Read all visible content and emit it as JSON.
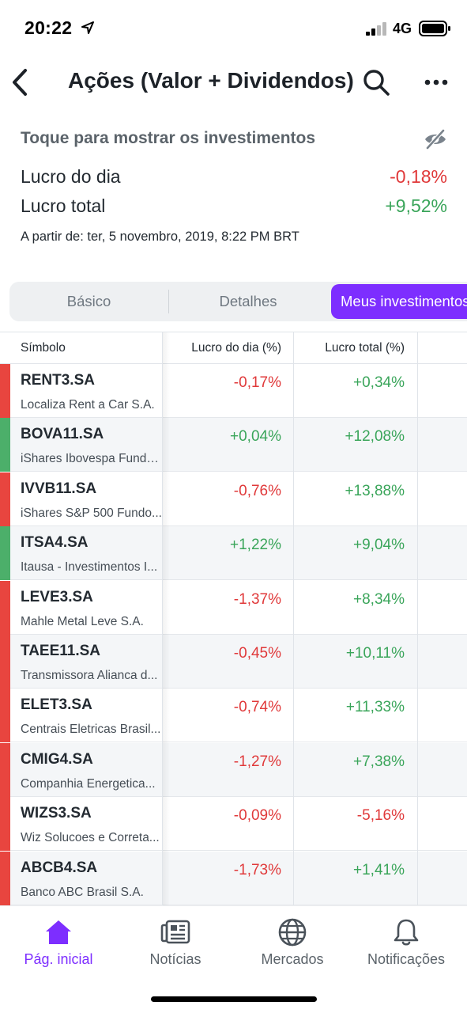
{
  "status_bar": {
    "time": "20:22",
    "network": "4G"
  },
  "header": {
    "title": "Ações (Valor + Dividendos)"
  },
  "summary": {
    "tap_hint": "Toque para mostrar os investimentos",
    "day_profit_label": "Lucro do dia",
    "day_profit_value": "-0,18%",
    "total_profit_label": "Lucro total",
    "total_profit_value": "+9,52%",
    "as_of": "A partir de: ter, 5 novembro, 2019, 8:22 PM BRT"
  },
  "tabs": [
    {
      "label": "Básico"
    },
    {
      "label": "Detalhes"
    },
    {
      "label": "Meus investimentos",
      "active": true
    }
  ],
  "table": {
    "columns": {
      "symbol": "Símbolo",
      "day": "Lucro do dia (%)",
      "total": "Lucro total (%)"
    },
    "rows": [
      {
        "symbol": "RENT3.SA",
        "name": "Localiza Rent a Car S.A.",
        "day": "-0,17%",
        "total": "+0,34%",
        "extra": "",
        "trend": "down"
      },
      {
        "symbol": "BOVA11.SA",
        "name": "iShares Ibovespa Fundo...",
        "day": "+0,04%",
        "total": "+12,08%",
        "extra": "+",
        "trend": "up"
      },
      {
        "symbol": "IVVB11.SA",
        "name": "iShares S&P 500 Fundo...",
        "day": "-0,76%",
        "total": "+13,88%",
        "extra": "+",
        "trend": "down"
      },
      {
        "symbol": "ITSA4.SA",
        "name": "Itausa - Investimentos I...",
        "day": "+1,22%",
        "total": "+9,04%",
        "extra": "+",
        "trend": "up"
      },
      {
        "symbol": "LEVE3.SA",
        "name": "Mahle Metal Leve S.A.",
        "day": "-1,37%",
        "total": "+8,34%",
        "extra": "",
        "trend": "down"
      },
      {
        "symbol": "TAEE11.SA",
        "name": "Transmissora Alianca d...",
        "day": "-0,45%",
        "total": "+10,11%",
        "extra": "",
        "trend": "down"
      },
      {
        "symbol": "ELET3.SA",
        "name": "Centrais Eletricas Brasil...",
        "day": "-0,74%",
        "total": "+11,33%",
        "extra": "",
        "trend": "down"
      },
      {
        "symbol": "CMIG4.SA",
        "name": "Companhia Energetica...",
        "day": "-1,27%",
        "total": "+7,38%",
        "extra": "",
        "trend": "down"
      },
      {
        "symbol": "WIZS3.SA",
        "name": "Wiz Solucoes e Correta...",
        "day": "-0,09%",
        "total": "-5,16%",
        "extra": "",
        "trend": "down"
      },
      {
        "symbol": "ABCB4.SA",
        "name": "Banco ABC Brasil S.A.",
        "day": "-1,73%",
        "total": "+1,41%",
        "extra": "",
        "trend": "down"
      }
    ]
  },
  "bottom_nav": [
    {
      "label": "Pág. inicial",
      "icon": "home-icon",
      "active": true
    },
    {
      "label": "Notícias",
      "icon": "news-icon"
    },
    {
      "label": "Mercados",
      "icon": "globe-icon"
    },
    {
      "label": "Notificações",
      "icon": "bell-icon"
    }
  ],
  "colors": {
    "accent": "#7d2eff",
    "positive": "#3aa55a",
    "negative": "#e0393a",
    "bar_positive": "#4caf6a",
    "bar_negative": "#e8453f"
  }
}
